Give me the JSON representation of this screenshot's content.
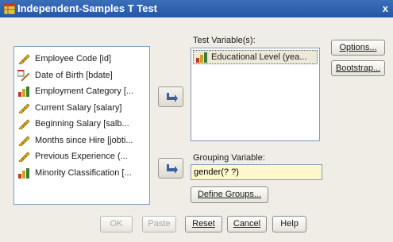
{
  "window": {
    "title": "Independent-Samples T Test",
    "close_label": "x"
  },
  "variables": [
    {
      "label": "Employee Code [id]",
      "icon": "scale-icon"
    },
    {
      "label": "Date of Birth [bdate]",
      "icon": "date-scale-icon"
    },
    {
      "label": "Employment Category [...",
      "icon": "ordinal-bar-icon"
    },
    {
      "label": "Current Salary [salary]",
      "icon": "scale-icon"
    },
    {
      "label": "Beginning Salary [salb...",
      "icon": "scale-icon"
    },
    {
      "label": "Months since Hire [jobti...",
      "icon": "scale-icon"
    },
    {
      "label": "Previous Experience (...",
      "icon": "scale-icon"
    },
    {
      "label": "Minority Classification [...",
      "icon": "ordinal-bar-icon"
    }
  ],
  "test_variables": {
    "label": "Test Variable(s):",
    "items": [
      {
        "label": "Educational Level (yea...",
        "icon": "ordinal-bar-icon"
      }
    ]
  },
  "grouping": {
    "label": "Grouping Variable:",
    "value": "gender(? ?)",
    "define_groups_label": "Define Groups..."
  },
  "side_buttons": {
    "options": "Options...",
    "bootstrap": "Bootstrap..."
  },
  "footer": {
    "ok": "OK",
    "paste": "Paste",
    "reset": "Reset",
    "cancel": "Cancel",
    "help": "Help"
  },
  "colors": {
    "titlebar": "#2458a6",
    "selection": "#316ac5",
    "input_bg": "#fff8cc",
    "arrow": "#3a5fa8"
  }
}
